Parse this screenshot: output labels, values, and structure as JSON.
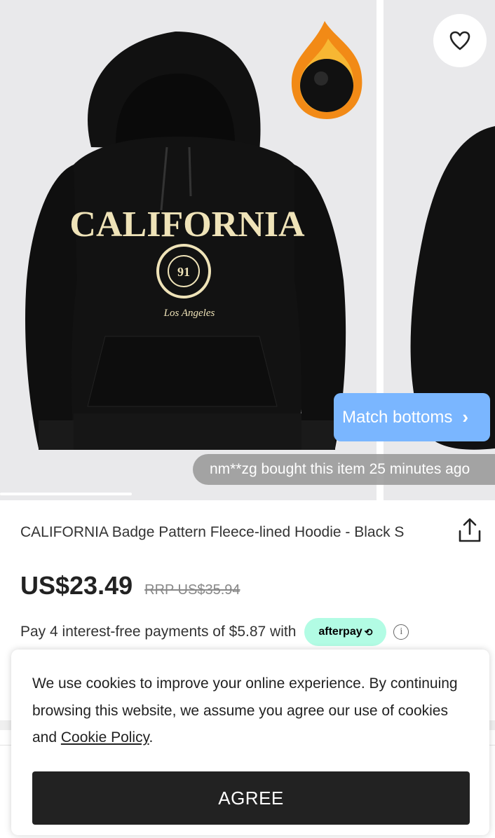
{
  "gallery": {
    "hoodie_print": {
      "word": "CALIFORNIA",
      "badge_number": "91",
      "script": "Los Angeles"
    },
    "match_button_label": "Match bottoms",
    "bought_notice": "nm**zg bought this item 25 minutes ago"
  },
  "product": {
    "title": "CALIFORNIA Badge Pattern Fleece-lined Hoodie - Black S",
    "price": "US$23.49",
    "rrp": "RRP US$35.94",
    "payment_text": "Pay 4 interest-free payments of $5.87 with",
    "afterpay_label": "afterpay"
  },
  "cookie_banner": {
    "text": "We use cookies to improve your online experience. By continuing browsing this website, we assume you agree our use of cookies and ",
    "link_text": "Cookie Policy",
    "suffix": ".",
    "button_label": "AGREE"
  },
  "colors": {
    "match_button": "#7ab6ff",
    "afterpay_badge": "#b2fce4",
    "agree_button": "#222222"
  },
  "icons": {
    "heart": "heart-icon",
    "share": "share-icon",
    "info": "info-icon",
    "chevron": "chevron-right-icon"
  }
}
